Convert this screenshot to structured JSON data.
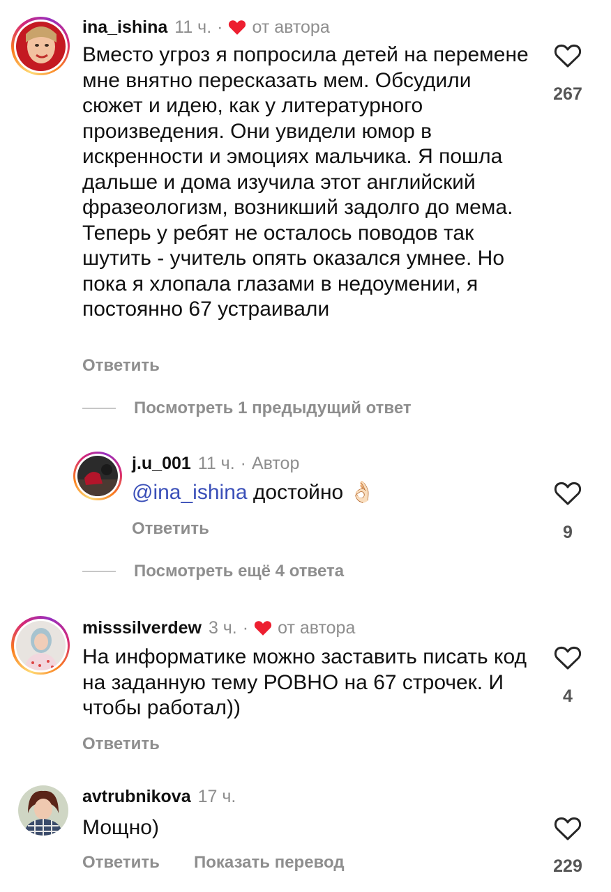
{
  "comments": [
    {
      "username": "ina_ishina",
      "time": "11 ч.",
      "author_like": "от автора",
      "text": "Вместо угроз я попросила детей на перемене мне внятно пересказать мем. Обсудили сюжет и идею, как у литературного произведения. Они увидели юмор в искренности и эмоциях мальчика.  Я пошла дальше и дома изучила этот английский фразеологизм, возникший задолго до мема. Теперь у ребят не осталось поводов так шутить - учитель опять оказался умнее. Но пока я хлопала глазами в недоумении, я постоянно 67 устраивали",
      "reply_label": "Ответить",
      "likes": "267",
      "view_replies": "Посмотреть 1 предыдущий ответ"
    },
    {
      "username": "j.u_001",
      "time": "11 ч.",
      "author_tag": "Автор",
      "mention": "@ina_ishina",
      "text": "достойно",
      "emoji": "👌🏻",
      "reply_label": "Ответить",
      "likes": "9",
      "view_replies": "Посмотреть ещё 4 ответа"
    },
    {
      "username": "misssilverdew",
      "time": "3 ч.",
      "author_like": "от автора",
      "text": "На информатике можно заставить писать код на заданную тему РОВНО на 67 строчек. И чтобы работал))",
      "reply_label": "Ответить",
      "likes": "4"
    },
    {
      "username": "avtrubnikova",
      "time": "17 ч.",
      "text": "Мощно)",
      "reply_label": "Ответить",
      "translate_label": "Показать перевод",
      "likes": "229"
    }
  ],
  "separator_dot": "·",
  "colors": {
    "heart_red": "#ed1f30",
    "meta_gray": "#8e8e8e",
    "mention_blue": "#3a4fb8"
  }
}
